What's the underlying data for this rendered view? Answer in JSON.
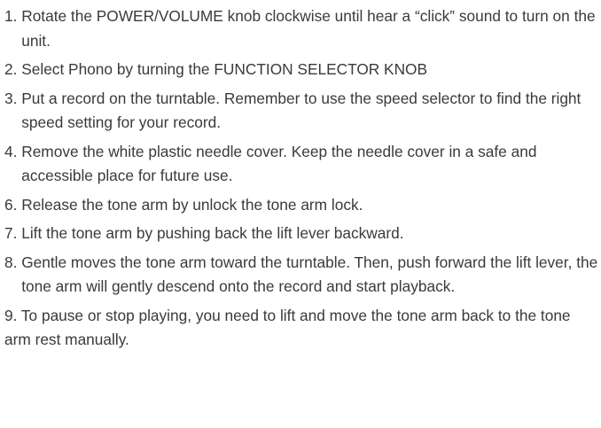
{
  "steps": [
    {
      "number": "1. ",
      "text": "Rotate the POWER/VOLUME knob clockwise until hear a “click” sound to turn on the unit."
    },
    {
      "number": "2. ",
      "text": "Select Phono by turning the FUNCTION SELECTOR KNOB"
    },
    {
      "number": "3. ",
      "text": "Put a record on the turntable. Remember to use the speed selector to find the right speed setting for your record."
    },
    {
      "number": "4. ",
      "text": "Remove the white plastic needle cover. Keep the needle cover in a safe and accessible place for future use."
    },
    {
      "number": "6. ",
      "text": "Release the tone arm by unlock the tone arm lock."
    },
    {
      "number": "7. ",
      "text": "Lift the tone arm by pushing back the lift lever backward."
    },
    {
      "number": "8. ",
      "text": "Gentle moves the tone arm toward the turntable. Then, push forward the lift lever, the tone arm will gently descend onto the record and start playback."
    },
    {
      "number": "9. ",
      "text": "To pause or stop playing, you need to lift and move the tone arm back to the tone arm rest manually."
    }
  ]
}
